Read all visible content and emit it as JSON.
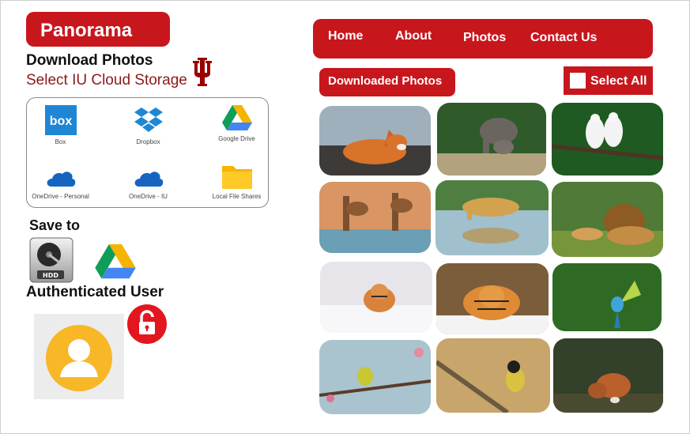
{
  "brand": {
    "title": "Panorama"
  },
  "download": {
    "heading": "Download Photos",
    "subheading": "Select IU Cloud Storage"
  },
  "clouds": [
    {
      "label": "Box",
      "icon": "box-icon"
    },
    {
      "label": "Dropbox",
      "icon": "dropbox-icon"
    },
    {
      "label": "Google Drive",
      "icon": "google-drive-icon"
    },
    {
      "label": "OneDrive - Personal",
      "icon": "onedrive-icon"
    },
    {
      "label": "OneDrive - IU",
      "icon": "onedrive-icon"
    },
    {
      "label": "Local File Shares",
      "icon": "folder-icon"
    }
  ],
  "save": {
    "heading": "Save to",
    "targets": [
      "hdd-icon",
      "google-drive-icon"
    ]
  },
  "auth": {
    "heading": "Authenticated User"
  },
  "nav": {
    "items": [
      "Home",
      "About",
      "Photos",
      "Contact Us"
    ]
  },
  "gallery": {
    "downloaded_label": "Downloaded Photos",
    "select_all_label": "Select All",
    "select_all_checked": false,
    "photos": [
      "red fox lying on rocks",
      "elephant with calf",
      "two white birds on branch",
      "giraffes drinking at water",
      "leopard reflected in water",
      "lion and lioness on grass",
      "tiger running in snow",
      "tiger crouching in snow",
      "green parrot in flight",
      "small yellow bird on blossom branch",
      "great tit on branch",
      "red fox cubs in forest"
    ]
  },
  "colors": {
    "accent": "#c8161d",
    "iu_crimson": "#990000",
    "select_text": "#8b1a1a"
  }
}
